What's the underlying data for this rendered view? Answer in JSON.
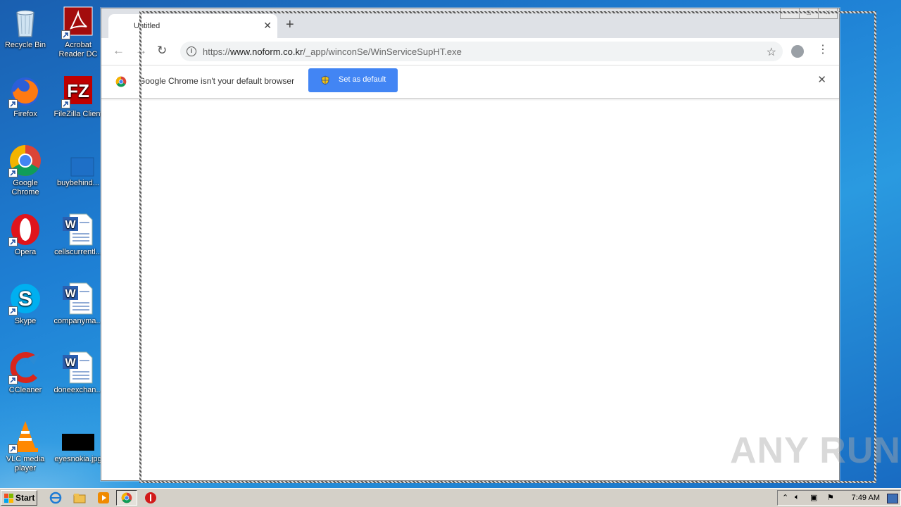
{
  "desktop": {
    "icons": [
      {
        "label": "Recycle Bin",
        "name": "recycle-bin-icon"
      },
      {
        "label": "Acrobat Reader DC",
        "name": "acrobat-icon"
      },
      {
        "label": "Firefox",
        "name": "firefox-icon"
      },
      {
        "label": "FileZilla Client",
        "name": "filezilla-icon"
      },
      {
        "label": "Google Chrome",
        "name": "chrome-icon"
      },
      {
        "label": "buybehind...",
        "name": "blank-file-icon"
      },
      {
        "label": "Opera",
        "name": "opera-icon"
      },
      {
        "label": "cellscurrentl...",
        "name": "word-doc-icon"
      },
      {
        "label": "Skype",
        "name": "skype-icon"
      },
      {
        "label": "companyma...",
        "name": "word-doc-icon"
      },
      {
        "label": "CCleaner",
        "name": "ccleaner-icon"
      },
      {
        "label": "doneexchan...",
        "name": "word-doc-icon"
      },
      {
        "label": "VLC media player",
        "name": "vlc-icon"
      },
      {
        "label": "eyesnokia.jpg",
        "name": "image-file-icon"
      }
    ]
  },
  "browser": {
    "tab_title": "Untitled",
    "url_prefix": "https://",
    "url_host": "www.noform.co.kr",
    "url_path": "/_app/winconSe/WinServiceSupHT.exe",
    "infobar_text": "Google Chrome isn't your default browser",
    "set_default_label": "Set as default"
  },
  "taskbar": {
    "start_label": "Start",
    "clock": "7:49 AM"
  },
  "watermark": "ANY RUN"
}
